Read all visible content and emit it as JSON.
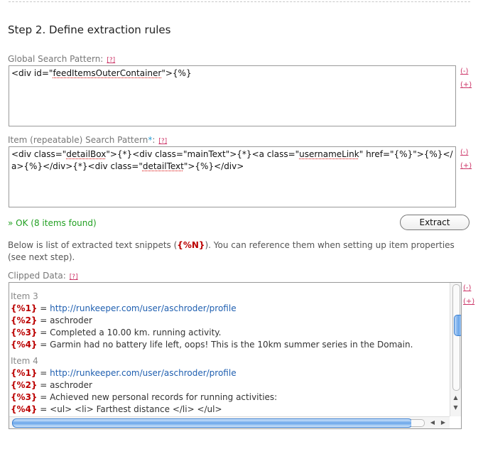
{
  "step_title": "Step 2. Define extraction rules",
  "global": {
    "label": "Global Search Pattern:",
    "help": "[?]",
    "pre": "<div id=\"",
    "sq": "feedItemsOuterContainer",
    "post": "\">{%}"
  },
  "item": {
    "label": "Item (repeatable) Search Pattern",
    "star": "*",
    "colon": ":",
    "help": "[?]",
    "p1": "<div class=\"",
    "sq1": "detailBox",
    "p2": "\">{*}<div class=\"mainText\">{*}<a class=\"",
    "sq2": "usernameLink",
    "p3": "\" href=\"{%}\">{%}</a>{%}</div>{*}<div class=\"",
    "sq3": "detailText",
    "p4": "\">{%}</div>"
  },
  "side": {
    "collapse": "(-)",
    "expand": "(+)"
  },
  "status": "» OK (8 items found)",
  "extract_button": "Extract",
  "description": {
    "pre": "Below is list of extracted text snippets (",
    "token": "{%N}",
    "post": "). You can reference them when setting up item properties (see next step)."
  },
  "clipped": {
    "label": "Clipped Data:",
    "help": "[?]",
    "items": [
      {
        "title": "Item 3",
        "fields": [
          {
            "key": "{%1}",
            "value": "http://runkeeper.com/user/aschroder/profile"
          },
          {
            "key": "{%2}",
            "value": "aschroder"
          },
          {
            "key": "{%3}",
            "value": "Completed a 10.00 km. running activity."
          },
          {
            "key": "{%4}",
            "value": "Garmin had no battery life left, oops! This is the 10km summer series in the Domain."
          }
        ]
      },
      {
        "title": "Item 4",
        "fields": [
          {
            "key": "{%1}",
            "value": "http://runkeeper.com/user/aschroder/profile"
          },
          {
            "key": "{%2}",
            "value": "aschroder"
          },
          {
            "key": "{%3}",
            "value": "Achieved new personal records for running activities:"
          },
          {
            "key": "{%4}",
            "value": "<ul> <li> Farthest distance </li> </ul>"
          }
        ]
      }
    ]
  }
}
